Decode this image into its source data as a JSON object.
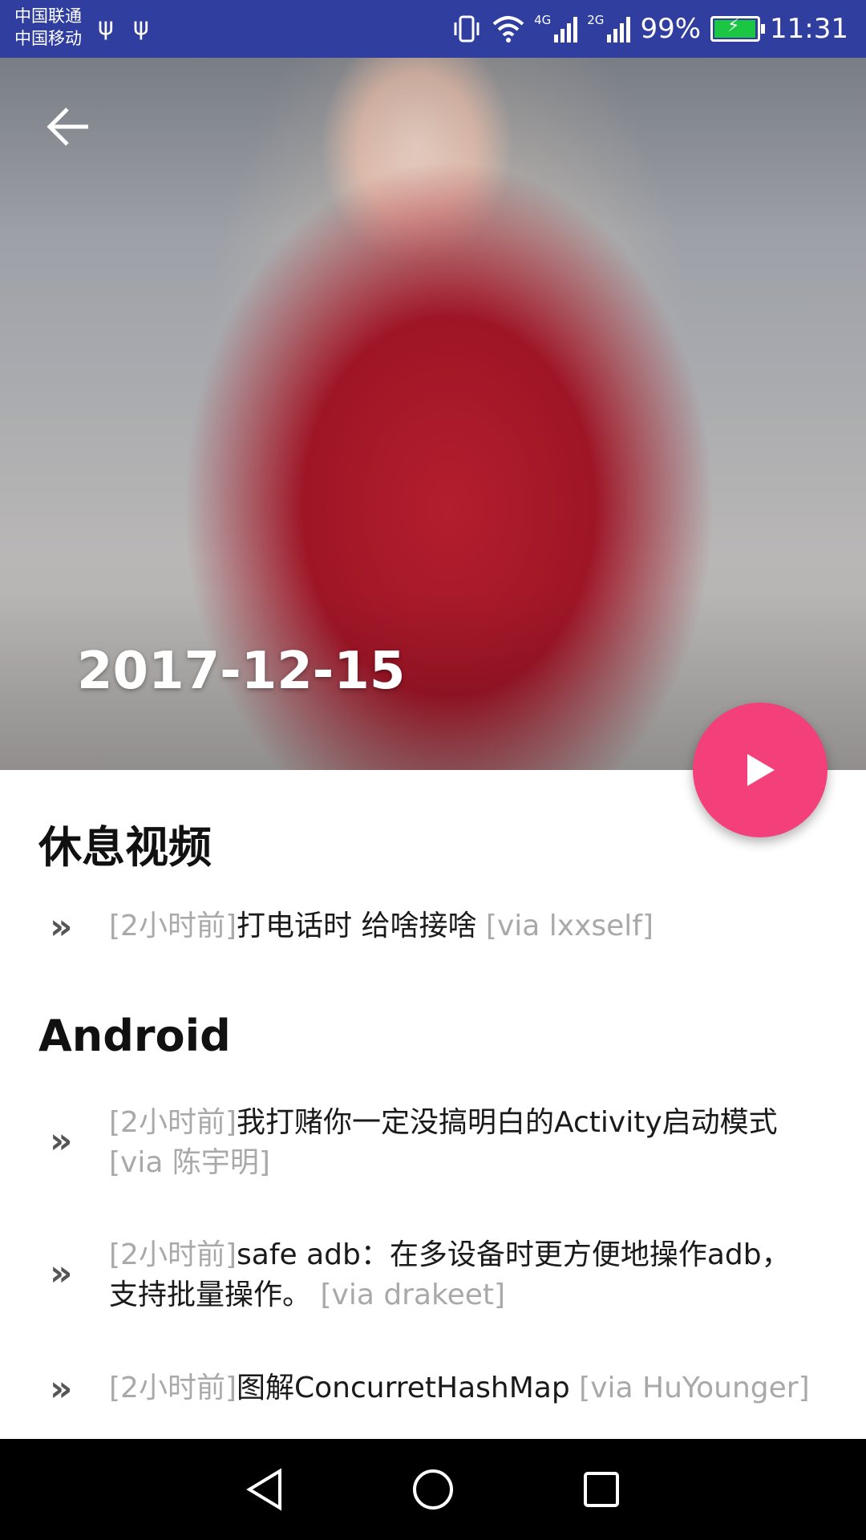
{
  "statusbar": {
    "carrier1": "中国联通",
    "carrier2": "中国移动",
    "net1": "4G",
    "net2": "2G",
    "battery_percent": "99%",
    "battery_level": 0.99,
    "time": "11:31",
    "icons": [
      "usb-icon",
      "usb-icon",
      "vibrate-icon",
      "wifi-icon",
      "signal-icon",
      "signal-icon",
      "battery-icon"
    ]
  },
  "header": {
    "date": "2017-12-15",
    "back_icon": "arrow-left-icon",
    "fab_icon": "play-icon",
    "fab_color": "#F4407A"
  },
  "sections": [
    {
      "title": "休息视频",
      "items": [
        {
          "time": "[2小时前]",
          "title": "打电话时 给啥接啥",
          "via": "[via lxxself]"
        }
      ]
    },
    {
      "title": "Android",
      "items": [
        {
          "time": "[2小时前]",
          "title": "我打赌你一定没搞明白的Activity启动模式",
          "via": "[via 陈宇明]"
        },
        {
          "time": "[2小时前]",
          "title": "safe adb：在多设备时更方便地操作adb，支持批量操作。",
          "via": "[via drakeet]"
        },
        {
          "time": "[2小时前]",
          "title": "图解ConcurretHashMap",
          "via": "[via HuYounger]"
        }
      ]
    }
  ],
  "bullet": "»",
  "navbar": {
    "icons": [
      "back-triangle-icon",
      "home-circle-icon",
      "recents-square-icon"
    ]
  },
  "colors": {
    "statusbar": "#303F9F",
    "muted_text": "#A9A9A9",
    "battery_fill": "#1BC742"
  }
}
